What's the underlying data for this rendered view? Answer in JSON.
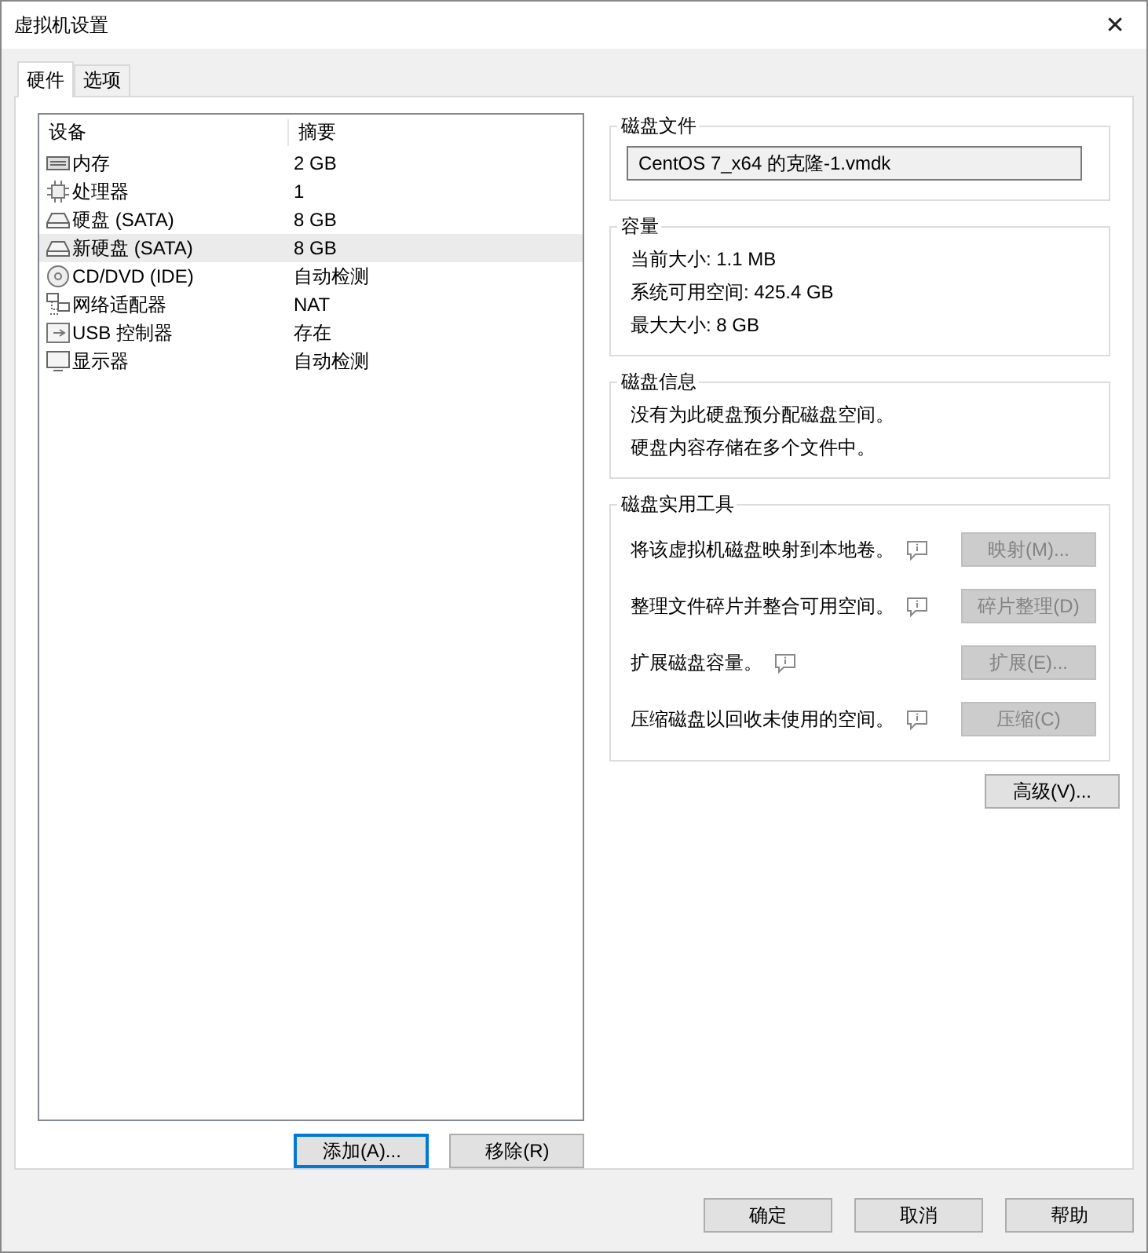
{
  "window": {
    "title": "虚拟机设置",
    "close": "✕"
  },
  "tabs": [
    {
      "label": "硬件",
      "selected": true
    },
    {
      "label": "选项",
      "selected": false
    }
  ],
  "devices": {
    "columns": [
      "设备",
      "摘要"
    ],
    "rows": [
      {
        "kind": "memory",
        "name": "内存",
        "summary": "2 GB",
        "selected": false
      },
      {
        "kind": "cpu",
        "name": "处理器",
        "summary": "1",
        "selected": false
      },
      {
        "kind": "disk",
        "name": "硬盘 (SATA)",
        "summary": "8 GB",
        "selected": false
      },
      {
        "kind": "disk",
        "name": "新硬盘 (SATA)",
        "summary": "8 GB",
        "selected": true
      },
      {
        "kind": "cdrom",
        "name": "CD/DVD (IDE)",
        "summary": "自动检测",
        "selected": false
      },
      {
        "kind": "network",
        "name": "网络适配器",
        "summary": "NAT",
        "selected": false
      },
      {
        "kind": "usb",
        "name": "USB 控制器",
        "summary": "存在",
        "selected": false
      },
      {
        "kind": "display",
        "name": "显示器",
        "summary": "自动检测",
        "selected": false
      }
    ]
  },
  "list_buttons": [
    {
      "label": "添加(A)...",
      "focused": true
    },
    {
      "label": "移除(R)",
      "focused": false
    }
  ],
  "disk_file": {
    "title": "磁盘文件",
    "value": "CentOS 7_x64 的克隆-1.vmdk"
  },
  "capacity": {
    "title": "容量",
    "lines": [
      "当前大小: 1.1 MB",
      "系统可用空间: 425.4 GB",
      "最大大小: 8 GB"
    ]
  },
  "disk_info": {
    "title": "磁盘信息",
    "lines": [
      "没有为此硬盘预分配磁盘空间。",
      "硬盘内容存储在多个文件中。"
    ]
  },
  "utilities": {
    "title": "磁盘实用工具",
    "rows": [
      {
        "text": "将该虚拟机磁盘映射到本地卷。",
        "button": "映射(M)...",
        "disabled": true
      },
      {
        "text": "整理文件碎片并整合可用空间。",
        "button": "碎片整理(D)",
        "disabled": true
      },
      {
        "text": "扩展磁盘容量。",
        "button": "扩展(E)...",
        "disabled": true
      },
      {
        "text": "压缩磁盘以回收未使用的空间。",
        "button": "压缩(C)",
        "disabled": true
      }
    ]
  },
  "advanced_button": "高级(V)...",
  "dialog_buttons": [
    "确定",
    "取消",
    "帮助"
  ]
}
